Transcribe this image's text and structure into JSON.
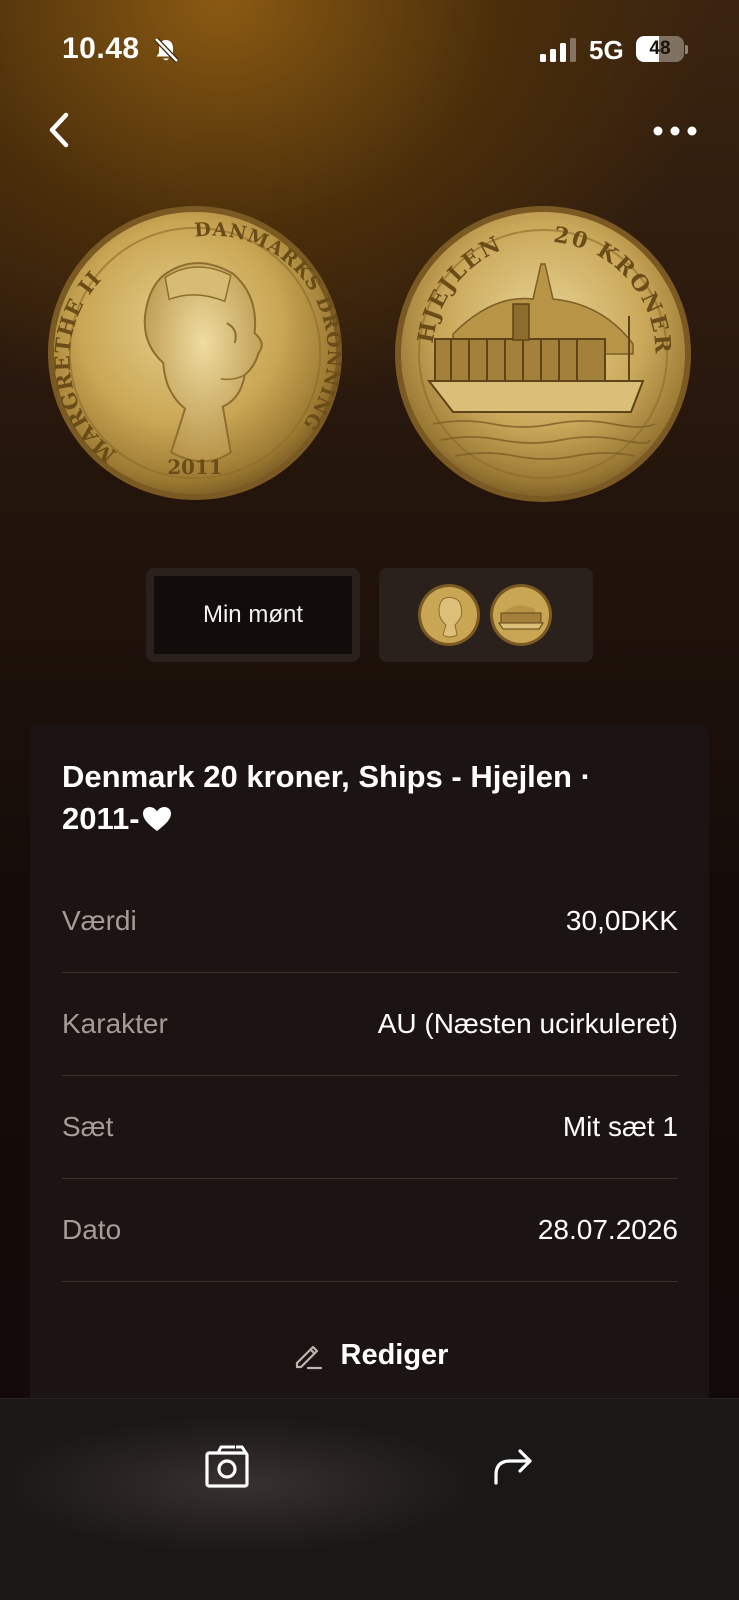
{
  "status_bar": {
    "time": "10.48",
    "network": "5G",
    "battery": "48",
    "battery_level": 0.48
  },
  "nav": {
    "back_icon": "chevron-left-icon",
    "more_icon": "ellipsis-icon"
  },
  "images": {
    "obverse_legend_left": "MARGRETHE II",
    "obverse_legend_right": "DANMARKS DRONNING",
    "obverse_year": "2011",
    "reverse_legend_left": "HJEJLEN",
    "reverse_legend_right": "20 KRONER"
  },
  "view_toggle": {
    "my_coin_label": "Min mønt"
  },
  "details": {
    "title": "Denmark 20 kroner, Ships - Hjejlen · 2011-",
    "rows": [
      {
        "label": "Værdi",
        "value": "30,0DKK"
      },
      {
        "label": "Karakter",
        "value": "AU (Næsten ucirkuleret)"
      },
      {
        "label": "Sæt",
        "value": "Mit sæt 1"
      },
      {
        "label": "Dato",
        "value": "28.07.2026"
      }
    ],
    "edit_label": "Rediger"
  },
  "bottom_bar": {
    "camera_icon": "camera-icon",
    "share_icon": "share-icon"
  },
  "colors": {
    "background_top": "#8a5a12",
    "background_bottom": "#120a09",
    "card": "#1c1412",
    "label_gray": "#a49c98",
    "coin_gold": "#c9a654"
  }
}
